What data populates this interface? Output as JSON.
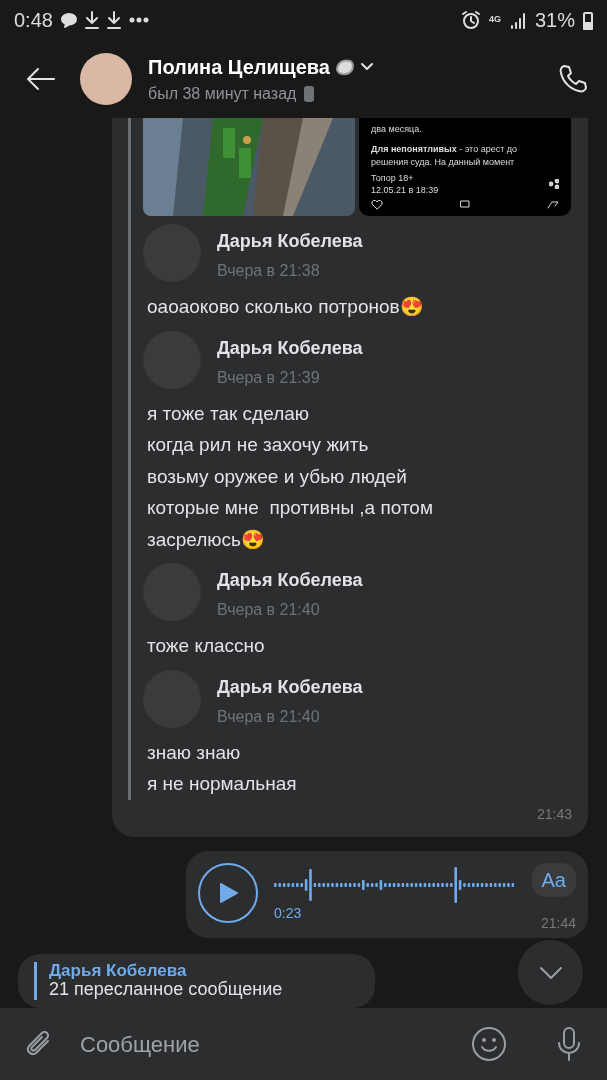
{
  "status_bar": {
    "time": "0:48",
    "network": "4G",
    "battery": "31%"
  },
  "header": {
    "name": "Полина Целищева",
    "status": "был 38 минут назад"
  },
  "forwarded_bubble": {
    "post": {
      "lines": [
        "два месяца.",
        "**Для непонятливых** - это арест до",
        "решения суда. На данный момент"
      ],
      "source": "Топор 18+",
      "date": "12.05.21 в 18:39"
    },
    "messages": [
      {
        "author": "Дарья Кобелева",
        "time": "Вчера в 21:38",
        "text": "оаоаоково сколько потронов😍"
      },
      {
        "author": "Дарья Кобелева",
        "time": "Вчера в 21:39",
        "text": "я тоже так сделаю\nкогда рил не захочу жить\nвозьму оружее и убью людей\nкоторые мне  противны ,а потом\nзасрелюсь😍"
      },
      {
        "author": "Дарья Кобелева",
        "time": "Вчера в 21:40",
        "text": "тоже классно"
      },
      {
        "author": "Дарья Кобелева",
        "time": "Вчера в 21:40",
        "text": "знаю знаю\nя не нормальная"
      }
    ],
    "time": "21:43"
  },
  "voice_message": {
    "duration": "0:23",
    "transcribe": "Aa",
    "time": "21:44"
  },
  "next_bubble": {
    "author": "Дарья Кобелева",
    "text": "21 пересланное сообщение"
  },
  "composer": {
    "placeholder": "Сообщение"
  }
}
